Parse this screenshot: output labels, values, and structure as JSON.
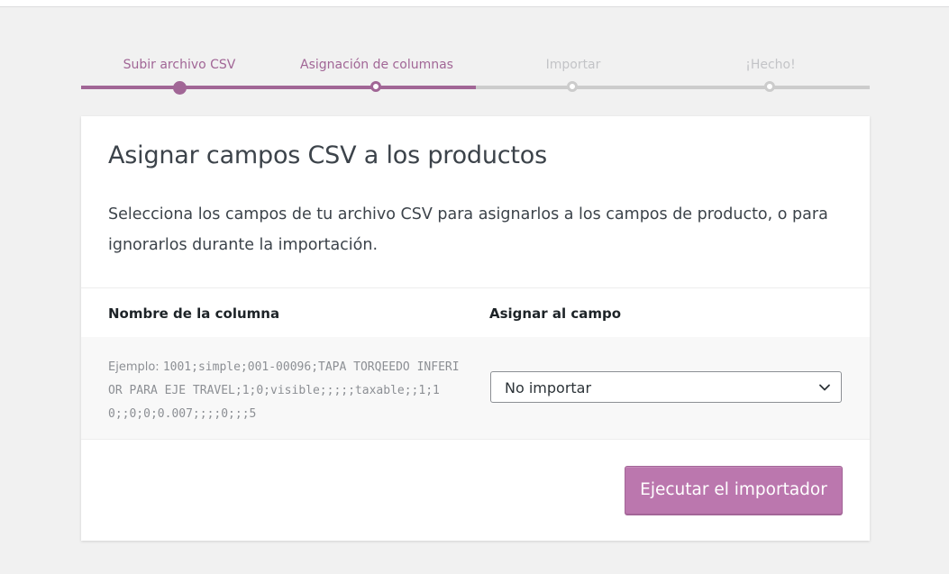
{
  "steps": [
    {
      "label": "Subir archivo CSV",
      "state": "done"
    },
    {
      "label": "Asignación de columnas",
      "state": "active"
    },
    {
      "label": "Importar",
      "state": "todo"
    },
    {
      "label": "¡Hecho!",
      "state": "todo"
    }
  ],
  "card": {
    "title": "Asignar campos CSV a los productos",
    "description": "Selecciona los campos de tu archivo CSV para asignarlos a los campos de producto, o para ignorarlos durante la importación."
  },
  "table": {
    "headers": {
      "column_name": "Nombre de la columna",
      "map_to_field": "Asignar al campo"
    },
    "rows": [
      {
        "sample_prefix": "Ejemplo: ",
        "sample": "1001;simple;001-00096;TAPA TORQEEDO INFERIOR PARA EJE TRAVEL;1;0;visible;;;;;taxable;;1;10;;0;0;0.007;;;;0;;;5",
        "selected_field": "No importar"
      }
    ]
  },
  "actions": {
    "run_label": "Ejecutar el importador"
  },
  "colors": {
    "accent": "#a16696",
    "button": "#bb77ae",
    "inactive": "#cccccc"
  }
}
